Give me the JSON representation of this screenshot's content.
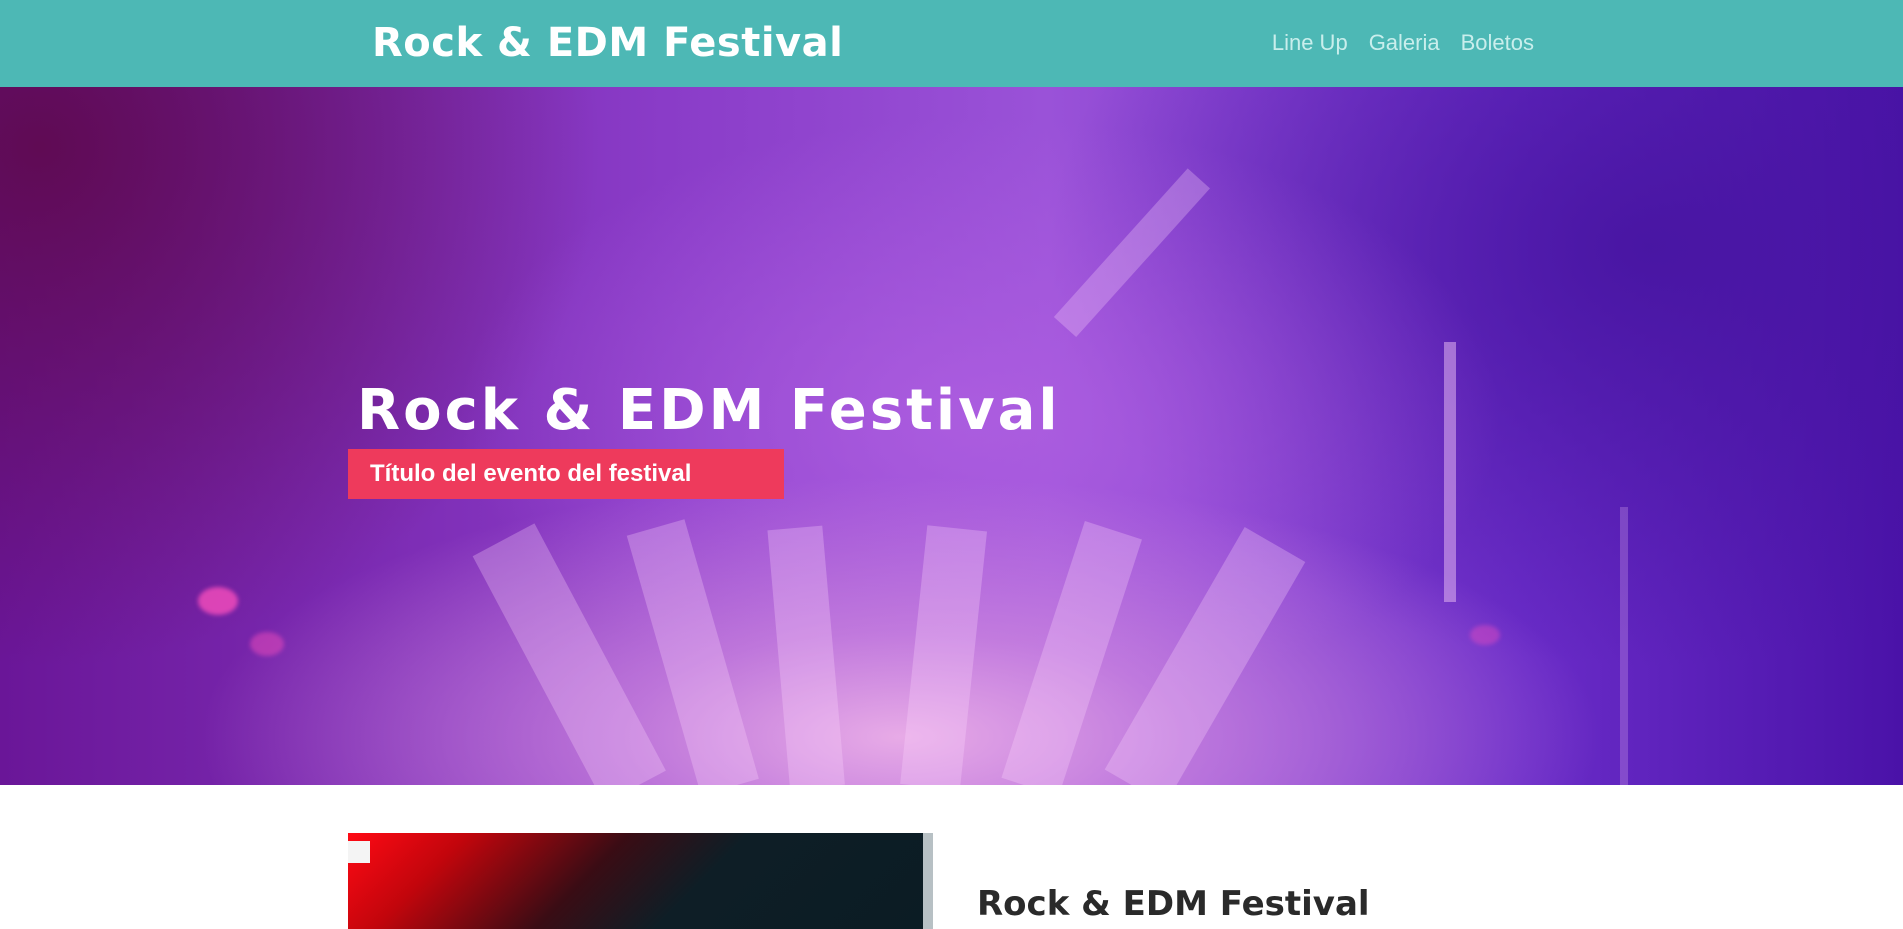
{
  "header": {
    "brand": "Rock & EDM Festival",
    "nav": [
      {
        "label": "Line Up"
      },
      {
        "label": "Galeria"
      },
      {
        "label": "Boletos"
      }
    ],
    "background_color": "#4db8b5"
  },
  "hero": {
    "title": "Rock & EDM Festival",
    "subtitle": "Título del evento del festival",
    "subtitle_bg_color": "#ee3a5c"
  },
  "content": {
    "section_title": "Rock & EDM Festival"
  }
}
